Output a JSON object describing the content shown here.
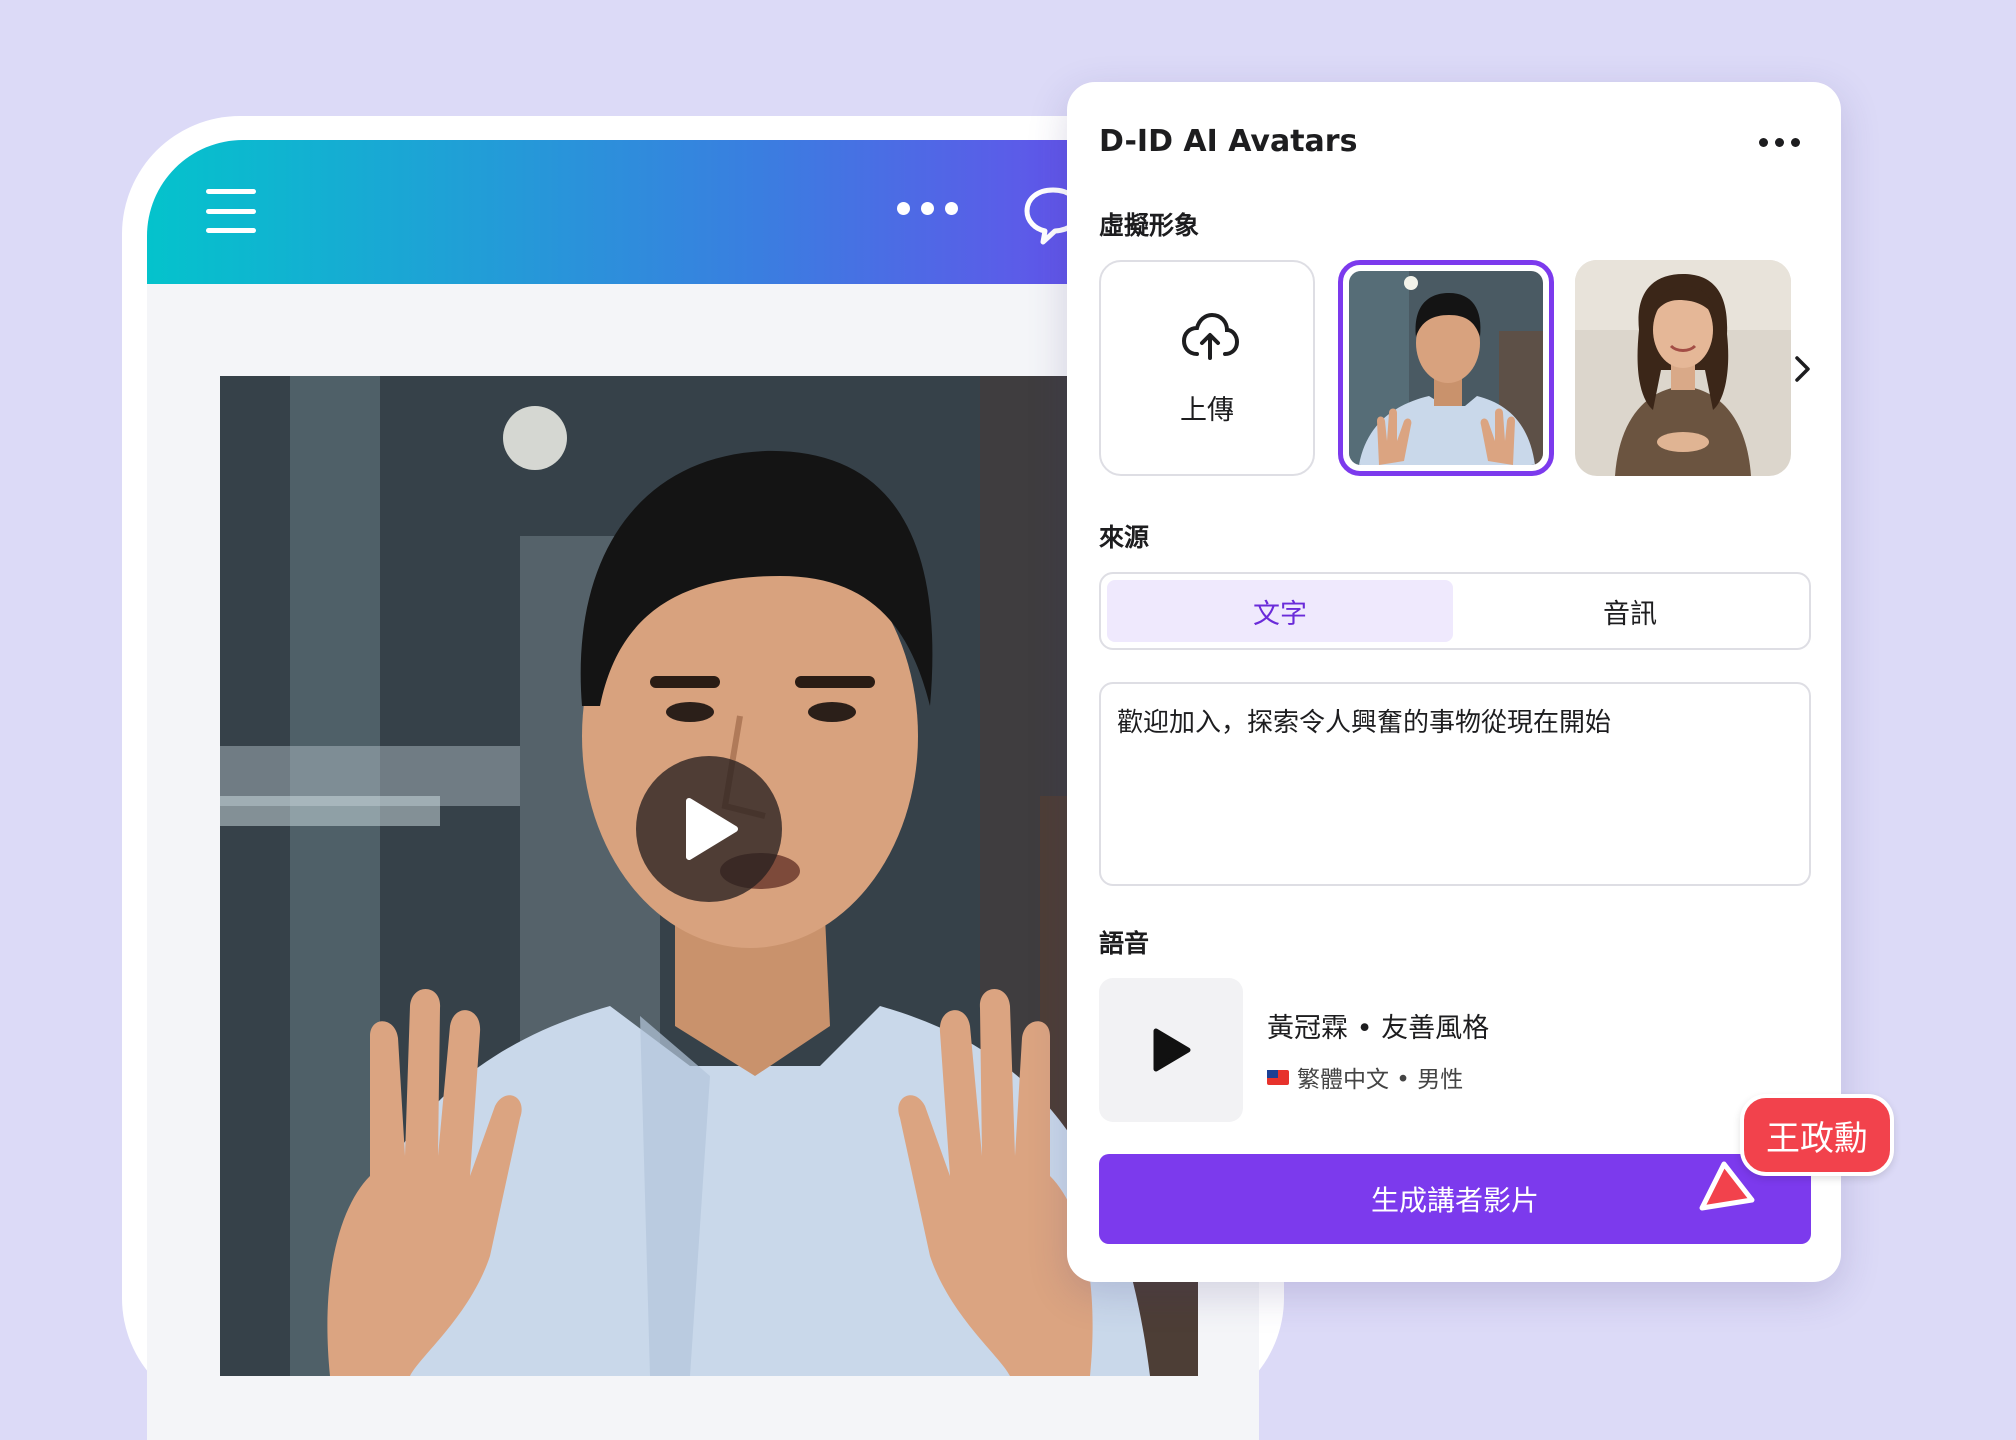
{
  "panel": {
    "title": "D-ID AI Avatars",
    "avatar_section_label": "虛擬形象",
    "upload_label": "上傳",
    "source_section_label": "來源",
    "source_tabs": [
      {
        "label": "文字",
        "selected": true
      },
      {
        "label": "音訊",
        "selected": false
      }
    ],
    "script_text": "歡迎加入，探索令人興奮的事物從現在開始",
    "voice_section_label": "語音",
    "voice": {
      "name": "黃冠霖 • 友善風格",
      "meta": "繁體中文 • 男性"
    },
    "generate_label": "生成講者影片"
  },
  "collaborator": {
    "name": "王政勳"
  },
  "colors": {
    "accent": "#7c3aed",
    "background": "#dcdaf7",
    "collaborator": "#f2424c",
    "header_gradient": [
      "#04c3cc",
      "#3a7ee0",
      "#7a3cf0"
    ]
  }
}
